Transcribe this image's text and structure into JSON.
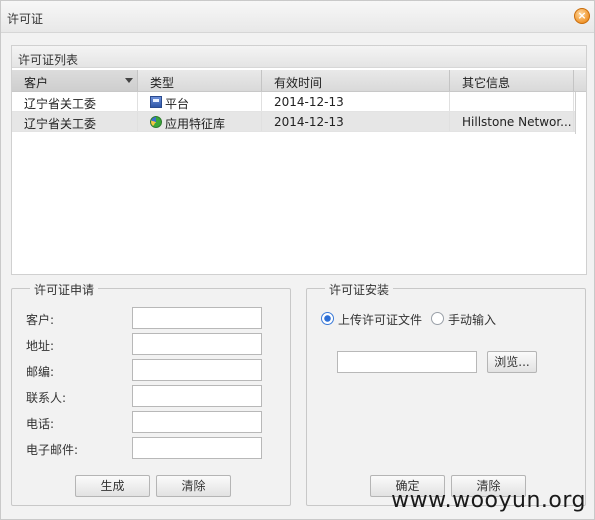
{
  "window": {
    "title": "许可证"
  },
  "license_list": {
    "title": "许可证列表",
    "columns": [
      "客户",
      "类型",
      "有效时间",
      "其它信息"
    ],
    "rows": [
      {
        "customer": "辽宁省关工委",
        "type": "平台",
        "type_icon": "platform-icon",
        "valid_time": "2014-12-13",
        "other": ""
      },
      {
        "customer": "辽宁省关工委",
        "type": "应用特征库",
        "type_icon": "app-signature-icon",
        "valid_time": "2014-12-13",
        "other": "Hillstone Networ..."
      }
    ]
  },
  "apply": {
    "legend": "许可证申请",
    "fields": [
      {
        "label": "客户:",
        "value": ""
      },
      {
        "label": "地址:",
        "value": ""
      },
      {
        "label": "邮编:",
        "value": ""
      },
      {
        "label": "联系人:",
        "value": ""
      },
      {
        "label": "电话:",
        "value": ""
      },
      {
        "label": "电子邮件:",
        "value": ""
      }
    ],
    "generate_label": "生成",
    "clear_label": "清除"
  },
  "install": {
    "legend": "许可证安装",
    "upload_option": "上传许可证文件",
    "manual_option": "手动输入",
    "selected_option": "upload",
    "file_path": "",
    "browse_label": "浏览...",
    "ok_label": "确定",
    "clear_label": "清除"
  },
  "watermark": "www.wooyun.org",
  "colors": {
    "close_button": "#f0962e",
    "radio_accent": "#2d6fd6"
  }
}
